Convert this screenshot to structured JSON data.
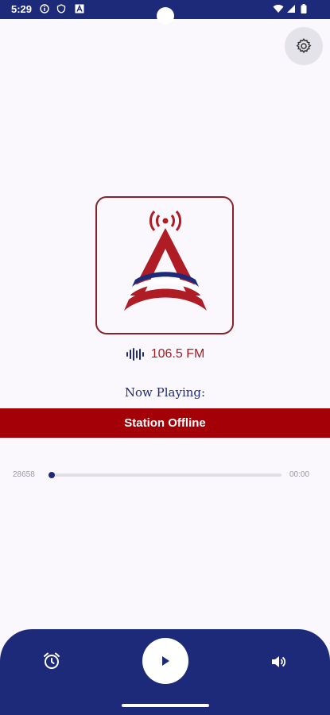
{
  "status_bar": {
    "time": "5:29",
    "icons": [
      "info-icon",
      "shield-icon",
      "a-icon",
      "wifi-icon",
      "signal-icon",
      "battery-icon"
    ]
  },
  "settings": {
    "icon": "gear-icon"
  },
  "station": {
    "logo": "broadcast-tower-logo",
    "frequency": "106.5 FM",
    "frequency_icon": "sound-wave-icon"
  },
  "now_playing": {
    "label": "Now Playing:",
    "status": "Station Offline"
  },
  "progress": {
    "elapsed": "28658",
    "duration": "00:00",
    "fraction": 0.01
  },
  "controls": {
    "alarm_icon": "alarm-clock-icon",
    "play_icon": "play-icon",
    "volume_icon": "volume-icon"
  },
  "colors": {
    "primary": "#1d2a7a",
    "accent": "#a30008",
    "background": "#fbf8fd"
  }
}
